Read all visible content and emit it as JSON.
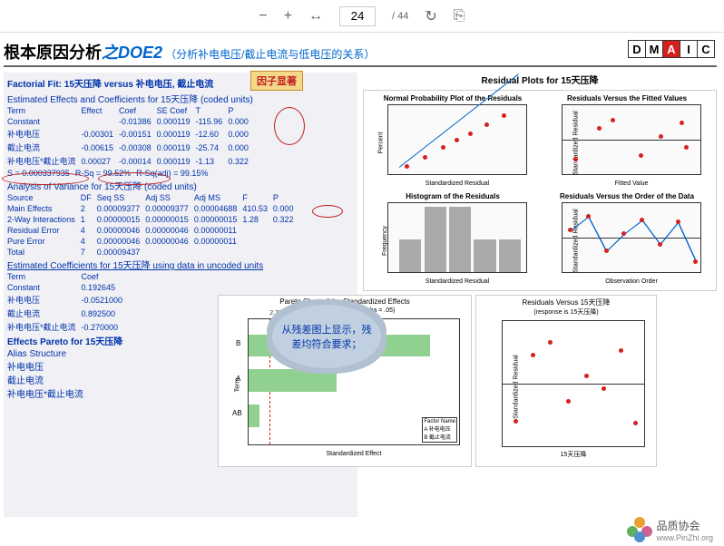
{
  "toolbar": {
    "page_current": "24",
    "page_total": "/ 44"
  },
  "dmaic": [
    "D",
    "M",
    "A",
    "I",
    "C"
  ],
  "title": {
    "main": "根本原因分析",
    "highlight": "之DOE2",
    "sub": "（分析补电电压/截止电流与低电压的关系）"
  },
  "analysis": {
    "fit_title": "Factorial Fit: 15天压降 versus 补电电压, 截止电流",
    "est_title": "Estimated Effects and Coefficients for 15天压降 (coded units)",
    "callout_factor": "因子显著",
    "effects_headers": [
      "Term",
      "Effect",
      "Coef",
      "SE Coef",
      "T",
      "P"
    ],
    "effects_rows": [
      [
        "Constant",
        "",
        "-0.01386",
        "0.000119",
        "-115.96",
        "0.000"
      ],
      [
        "补电电压",
        "-0.00301",
        "-0.00151",
        "0.000119",
        "-12.60",
        "0.000"
      ],
      [
        "截止电流",
        "-0.00615",
        "-0.00308",
        "0.000119",
        "-25.74",
        "0.000"
      ],
      [
        "补电电压*截止电流",
        "0.00027",
        "-0.00014",
        "0.000119",
        "-1.13",
        "0.322"
      ]
    ],
    "s_line": [
      "S = 0.000337935",
      "R-Sq = 99.52%",
      "R-Sq(adj) = 99.15%"
    ],
    "anova_title": "Analysis of Variance for 15天压降 (coded units)",
    "anova_headers": [
      "Source",
      "DF",
      "Seq SS",
      "Adj SS",
      "Adj MS",
      "F",
      "P"
    ],
    "anova_rows": [
      [
        "Main Effects",
        "2",
        "0.00009377",
        "0.00009377",
        "0.00004688",
        "410.53",
        "0.000"
      ],
      [
        "2-Way Interactions",
        "1",
        "0.00000015",
        "0.00000015",
        "0.00000015",
        "1.28",
        "0.322"
      ],
      [
        "Residual Error",
        "4",
        "0.00000046",
        "0.00000046",
        "0.00000011",
        "",
        ""
      ],
      [
        "Pure Error",
        "4",
        "0.00000046",
        "0.00000046",
        "0.00000011",
        "",
        ""
      ],
      [
        "Total",
        "7",
        "0.00009437",
        "",
        "",
        "",
        ""
      ]
    ],
    "uncoded_title": "Estimated Coefficients for 15天压降 using data in uncoded units",
    "uncoded_headers": [
      "Term",
      "Coef"
    ],
    "uncoded_rows": [
      [
        "Constant",
        "0.192645"
      ],
      [
        "补电电压",
        "-0.0521000"
      ],
      [
        "截止电流",
        "0.892500"
      ],
      [
        "补电电压*截止电流",
        "-0.270000"
      ]
    ],
    "pareto_title": "Effects Pareto for 15天压降",
    "alias_title": "Alias Structure",
    "alias_rows": [
      "补电电压",
      "截止电流",
      "补电电压*截止电流"
    ]
  },
  "cloud_text": "从残差图上显示，残差均符合要求；",
  "charts": {
    "grid_title": "Residual Plots for 15天压降",
    "c1": {
      "title": "Normal Probability Plot of the Residuals",
      "ylabel": "Percent",
      "xlabel": "Standardized Residual"
    },
    "c2": {
      "title": "Residuals Versus the Fitted Values",
      "ylabel": "Standardized Residual",
      "xlabel": "Fitted Value"
    },
    "c3": {
      "title": "Histogram of the Residuals",
      "ylabel": "Frequency",
      "xlabel": "Standardized Residual"
    },
    "c4": {
      "title": "Residuals Versus the Order of the Data",
      "ylabel": "Standardized Residual",
      "xlabel": "Observation Order"
    },
    "pareto": {
      "title": "Pareto Chart of the Standardized Effects",
      "sub": "(response is 15天压降, Alpha = .05)",
      "ylabel": "Term",
      "xlabel": "Standardized Effect",
      "legend_title": "Factor  Name",
      "legend": [
        "A  补电电压",
        "B  截止电流"
      ],
      "threshold": "2.78"
    },
    "resid2": {
      "title": "Residuals Versus 15天压降",
      "sub": "(response is 15天压降)",
      "ylabel": "Standardized Residual",
      "xlabel": "15天压降"
    }
  },
  "chart_data": [
    {
      "type": "scatter",
      "name": "normal_probability",
      "x": [
        -1.5,
        -1,
        -0.5,
        0,
        0.5,
        1,
        1.5
      ],
      "y": [
        5,
        15,
        30,
        50,
        70,
        85,
        95
      ],
      "xlim": [
        -2,
        2
      ],
      "ylim": [
        1,
        99
      ],
      "trend": true
    },
    {
      "type": "scatter",
      "name": "resid_vs_fitted",
      "x": [
        -0.018,
        -0.016,
        -0.015,
        -0.012,
        -0.011,
        -0.01,
        -0.01
      ],
      "y": [
        -1,
        0.5,
        1,
        -0.8,
        0.2,
        0.9,
        -0.3
      ],
      "xlim": [
        -0.018,
        -0.01
      ],
      "ylim": [
        -1.5,
        1.5
      ]
    },
    {
      "type": "bar",
      "name": "histogram",
      "categories": [
        -2,
        -1,
        0,
        1,
        2
      ],
      "values": [
        1,
        2,
        2,
        1,
        1
      ],
      "xlim": [
        -2,
        2
      ],
      "ylim": [
        0,
        2
      ]
    },
    {
      "type": "line",
      "name": "resid_vs_order",
      "x": [
        1,
        2,
        3,
        4,
        5,
        6,
        7,
        8
      ],
      "y": [
        0.5,
        1.2,
        -0.8,
        0.3,
        1.0,
        -0.5,
        0.9,
        -1.3
      ],
      "xlim": [
        1,
        8
      ],
      "ylim": [
        -1.5,
        1.5
      ]
    },
    {
      "type": "bar",
      "name": "pareto_effects",
      "orientation": "horizontal",
      "categories": [
        "B",
        "A",
        "AB"
      ],
      "values": [
        25.74,
        12.6,
        1.13
      ],
      "threshold": 2.78,
      "xlim": [
        0,
        30
      ]
    },
    {
      "type": "scatter",
      "name": "resid_vs_response",
      "x": [
        -0.02,
        -0.018,
        -0.016,
        -0.014,
        -0.012,
        -0.01,
        -0.01,
        -0.008
      ],
      "y": [
        -1.0,
        0.8,
        1.2,
        -0.5,
        0.3,
        -0.2,
        0.9,
        -1.1
      ],
      "xlim": [
        -0.02,
        -0.008
      ],
      "ylim": [
        -1.5,
        1.5
      ]
    }
  ],
  "footer": {
    "brand": "品质协会",
    "url": "www.PinZhi.org"
  }
}
